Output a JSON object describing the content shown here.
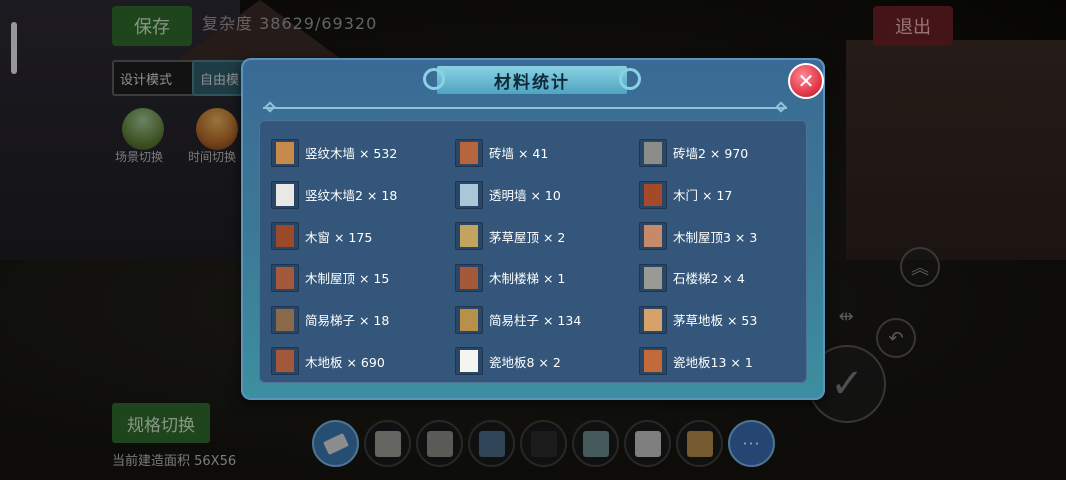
{
  "hud": {
    "save": "保存",
    "complexity": "复杂度 38629/69320",
    "exit": "退出",
    "design_mode": "设计模式",
    "free_mode": "自由模",
    "scene_switch": "场景切换",
    "time_switch": "时间切换",
    "spec_switch": "规格切换",
    "build_area": "当前建造面积 56X56",
    "more": "···"
  },
  "modal": {
    "title": "材料统计",
    "close": "✕",
    "materials": [
      {
        "label": "竖纹木墙 × 532",
        "icon": "vertical-wood-wall-icon",
        "color": "#c88a4a"
      },
      {
        "label": "砖墙 × 41",
        "icon": "brick-wall-icon",
        "color": "#b5663c"
      },
      {
        "label": "砖墙2 × 970",
        "icon": "brick-wall-2-icon",
        "color": "#8c8c88"
      },
      {
        "label": "竖纹木墙2 × 18",
        "icon": "vertical-wood-wall-2-icon",
        "color": "#e8e8e4"
      },
      {
        "label": "透明墙 × 10",
        "icon": "transparent-wall-icon",
        "color": "#a9c7d9"
      },
      {
        "label": "木门 × 17",
        "icon": "wooden-door-icon",
        "color": "#a44a2a"
      },
      {
        "label": "木窗 × 175",
        "icon": "wooden-window-icon",
        "color": "#9a4a28"
      },
      {
        "label": "茅草屋顶 × 2",
        "icon": "thatch-roof-icon",
        "color": "#c2a360"
      },
      {
        "label": "木制屋顶3 × 3",
        "icon": "wooden-roof-3-icon",
        "color": "#c68a6a"
      },
      {
        "label": "木制屋顶 × 15",
        "icon": "wooden-roof-icon",
        "color": "#a45a3a"
      },
      {
        "label": "木制楼梯 × 1",
        "icon": "wooden-stairs-icon",
        "color": "#a45a3a"
      },
      {
        "label": "石楼梯2 × 4",
        "icon": "stone-stairs-2-icon",
        "color": "#9a9a94"
      },
      {
        "label": "简易梯子 × 18",
        "icon": "simple-ladder-icon",
        "color": "#8a6a4a"
      },
      {
        "label": "简易柱子 × 134",
        "icon": "simple-pillar-icon",
        "color": "#b8904a"
      },
      {
        "label": "茅草地板 × 53",
        "icon": "thatch-floor-icon",
        "color": "#d6a26a"
      },
      {
        "label": "木地板 × 690",
        "icon": "wooden-floor-icon",
        "color": "#a4583a"
      },
      {
        "label": "瓷地板8 × 2",
        "icon": "tile-floor-8-icon",
        "color": "#f4f4f0"
      },
      {
        "label": "瓷地板13 × 1",
        "icon": "tile-floor-13-icon",
        "color": "#c26a3a"
      }
    ]
  },
  "hotbar": [
    {
      "icon": "eraser-icon",
      "color": "#d9d9d9"
    },
    {
      "icon": "stone-block-icon",
      "color": "#9a9a96"
    },
    {
      "icon": "arch-block-icon",
      "color": "#8a8a86"
    },
    {
      "icon": "window-frame-icon",
      "color": "#4a6a86"
    },
    {
      "icon": "dark-panel-icon",
      "color": "#2a2a2a"
    },
    {
      "icon": "wardrobe-icon",
      "color": "#6a8a8a"
    },
    {
      "icon": "phone-booth-icon",
      "color": "#c4c4c4"
    },
    {
      "icon": "door-panel-icon",
      "color": "#b48a4a"
    }
  ]
}
